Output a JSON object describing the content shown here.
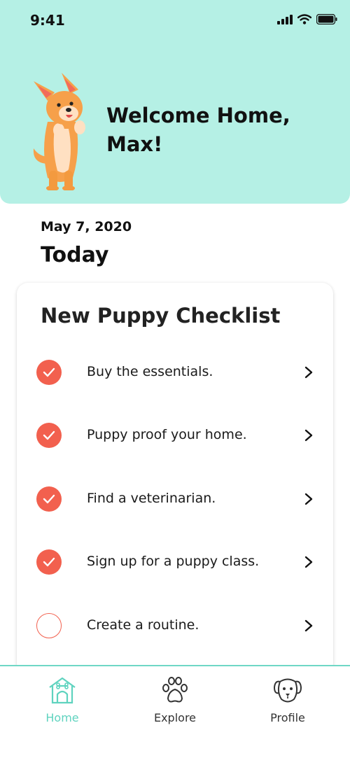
{
  "status_bar": {
    "time": "9:41"
  },
  "header": {
    "welcome": "Welcome Home, Max!"
  },
  "main": {
    "date": "May 7, 2020",
    "section_title": "Today"
  },
  "checklist": {
    "title": "New Puppy Checklist",
    "items": [
      {
        "label": "Buy the essentials.",
        "done": true
      },
      {
        "label": "Puppy proof your home.",
        "done": true
      },
      {
        "label": "Find a veterinarian.",
        "done": true
      },
      {
        "label": "Sign up for a puppy class.",
        "done": true
      },
      {
        "label": "Create a routine.",
        "done": false
      }
    ]
  },
  "tabbar": {
    "tabs": [
      {
        "label": "Home",
        "icon": "doghouse-icon",
        "active": true
      },
      {
        "label": "Explore",
        "icon": "paw-icon",
        "active": false
      },
      {
        "label": "Profile",
        "icon": "dog-face-icon",
        "active": false
      }
    ]
  },
  "colors": {
    "header_bg": "#b5f0e5",
    "accent": "#f2604e",
    "active_tab": "#5fd3bf"
  }
}
